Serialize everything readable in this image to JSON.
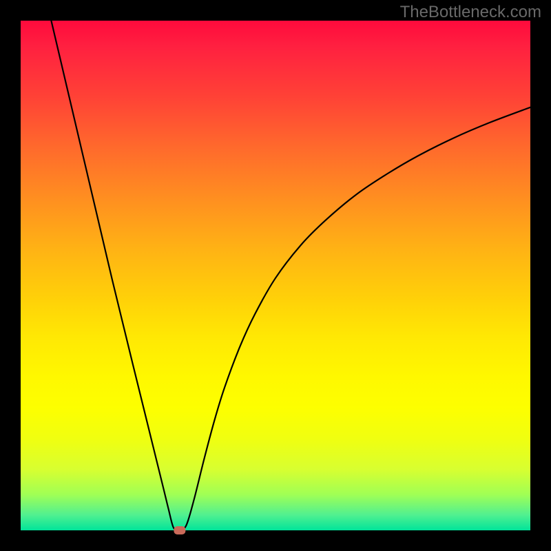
{
  "watermark": "TheBottleneck.com",
  "chart_data": {
    "type": "line",
    "title": "",
    "xlabel": "",
    "ylabel": "",
    "xlim": [
      0,
      100
    ],
    "ylim": [
      0,
      100
    ],
    "background_gradient": {
      "top": "#ff0a3c",
      "bottom": "#00e49a",
      "description": "vertical red-to-green through orange/yellow"
    },
    "series": [
      {
        "name": "bottleneck-curve",
        "color": "#000000",
        "x": [
          6.0,
          8.0,
          10.0,
          12.0,
          14.0,
          16.0,
          18.0,
          20.0,
          22.0,
          24.0,
          26.0,
          28.0,
          29.0,
          30.0,
          31.2,
          32.5,
          34.0,
          36.0,
          38.0,
          40.0,
          43.0,
          46.0,
          50.0,
          55.0,
          60.0,
          66.0,
          72.0,
          78.0,
          85.0,
          92.0,
          100.0
        ],
        "values": [
          100.0,
          91.5,
          83.0,
          74.5,
          66.0,
          57.5,
          49.0,
          40.8,
          32.6,
          24.5,
          16.4,
          8.3,
          4.2,
          0.5,
          0.0,
          1.0,
          6.0,
          14.0,
          21.5,
          28.0,
          36.0,
          42.5,
          49.5,
          56.0,
          61.0,
          66.0,
          70.0,
          73.5,
          77.0,
          80.0,
          83.0
        ]
      }
    ],
    "marker": {
      "name": "minimum-point",
      "x": 31.2,
      "y": 0.0,
      "shape": "rounded-rect",
      "color": "#c96a5a"
    }
  }
}
